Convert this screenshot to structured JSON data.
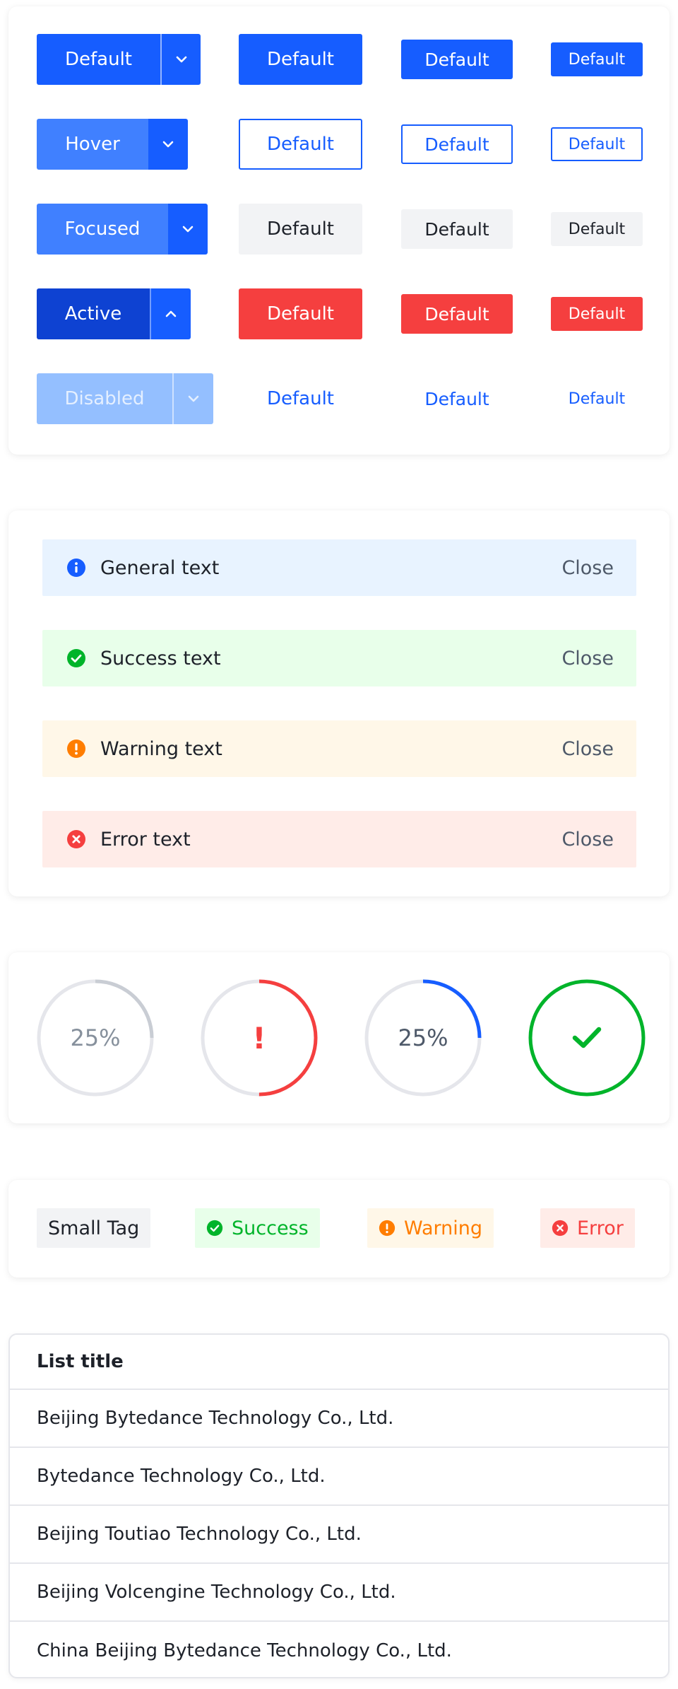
{
  "buttons": {
    "split": [
      {
        "label": "Default",
        "state": "default",
        "arrow": "chevron-down"
      },
      {
        "label": "Hover",
        "state": "hover",
        "arrow": "chevron-down"
      },
      {
        "label": "Focused",
        "state": "focused",
        "arrow": "chevron-down"
      },
      {
        "label": "Active",
        "state": "active",
        "arrow": "chevron-up"
      },
      {
        "label": "Disabled",
        "state": "disabled",
        "arrow": "chevron-down"
      }
    ],
    "primary": [
      "Default",
      "Default",
      "Default"
    ],
    "outline": [
      "Default",
      "Default",
      "Default"
    ],
    "secondary": [
      "Default",
      "Default",
      "Default"
    ],
    "danger": [
      "Default",
      "Default",
      "Default"
    ],
    "text": [
      "Default",
      "Default",
      "Default"
    ]
  },
  "alerts": [
    {
      "type": "info",
      "icon": "info-circle-icon",
      "text": "General text",
      "close": "Close",
      "color": "#165dff"
    },
    {
      "type": "success",
      "icon": "check-circle-icon",
      "text": "Success text",
      "close": "Close",
      "color": "#00b42a"
    },
    {
      "type": "warning",
      "icon": "exclamation-circle-icon",
      "text": "Warning text",
      "close": "Close",
      "color": "#ff7d00"
    },
    {
      "type": "error",
      "icon": "close-circle-icon",
      "text": "Error text",
      "close": "Close",
      "color": "#f53f3f"
    }
  ],
  "progress": [
    {
      "label": "25%",
      "percent": 25,
      "status": "inactive",
      "color": "#c9cdd4"
    },
    {
      "label": "!",
      "percent": 50,
      "status": "error",
      "color": "#f53f3f"
    },
    {
      "label": "25%",
      "percent": 25,
      "status": "normal",
      "color": "#165dff"
    },
    {
      "label": "",
      "percent": 100,
      "status": "success",
      "color": "#00b42a"
    }
  ],
  "tags": [
    {
      "type": "default",
      "text": "Small Tag"
    },
    {
      "type": "success",
      "text": "Success",
      "icon": "check-circle-icon"
    },
    {
      "type": "warning",
      "text": "Warning",
      "icon": "exclamation-circle-icon"
    },
    {
      "type": "error",
      "text": "Error",
      "icon": "close-circle-icon"
    }
  ],
  "list": {
    "title": "List title",
    "items": [
      "Beijing Bytedance Technology Co., Ltd.",
      "Bytedance Technology Co., Ltd.",
      "Beijing Toutiao Technology Co., Ltd.",
      "Beijing Volcengine Technology Co., Ltd.",
      "China Beijing Bytedance Technology Co., Ltd."
    ]
  },
  "colors": {
    "primary": "#165dff",
    "success": "#00b42a",
    "warning": "#ff7d00",
    "danger": "#f53f3f"
  }
}
